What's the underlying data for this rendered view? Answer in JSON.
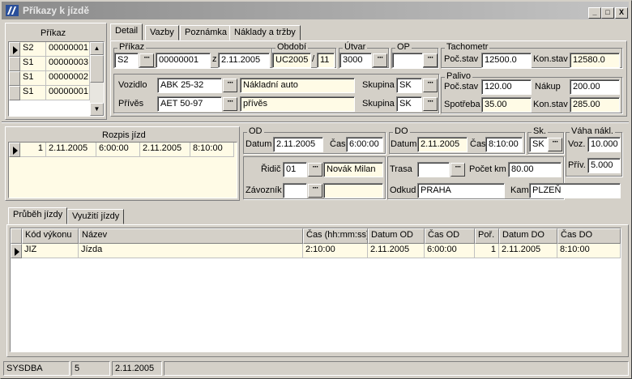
{
  "window": {
    "title": "Příkazy k jízdě",
    "min": "_",
    "max": "□",
    "close": "X"
  },
  "prikaz_list": {
    "header": "Příkaz",
    "rows": [
      {
        "a": "S2",
        "b": "00000001"
      },
      {
        "a": "S1",
        "b": "00000003"
      },
      {
        "a": "S1",
        "b": "00000002"
      },
      {
        "a": "S1",
        "b": "00000001"
      }
    ]
  },
  "top_tabs": [
    "Detail",
    "Vazby",
    "Poznámka",
    "Náklady a tržby"
  ],
  "detail": {
    "prikaz_label": "Příkaz",
    "prikaz_series": "S2",
    "prikaz_number": "00000001",
    "z_label": "z",
    "prikaz_date": "2.11.2005",
    "obdobi_label": "Období",
    "obdobi_a": "UC2005",
    "obdobi_sep": "/",
    "obdobi_b": "11",
    "utvar_label": "Útvar",
    "utvar": "3000",
    "op_label": "OP",
    "op": "",
    "tacho_label": "Tachometr",
    "poc_stav_label": "Poč.stav",
    "tacho_poc": "12500.0",
    "kon_stav_label": "Kon.stav",
    "tacho_kon": "12580.0",
    "vozidlo_label": "Vozidlo",
    "vozidlo": "ABK 25-32",
    "vozidlo_name": "Nákladní auto",
    "skupina_label": "Skupina",
    "vozidlo_skupina": "SK",
    "prives_label": "Přívěs",
    "prives": "AET 50-97",
    "prives_name": "přívěs",
    "prives_skupina": "SK",
    "palivo_label": "Palivo",
    "palivo_poc_label": "Poč.stav",
    "palivo_poc": "120.00",
    "nakup_label": "Nákup",
    "nakup": "200.00",
    "spotreba_label": "Spotřeba",
    "spotreba": "35.00",
    "palivo_kon_label": "Kon.stav",
    "palivo_kon": "285.00"
  },
  "rozpis": {
    "header": "Rozpis jízd",
    "rows": [
      {
        "n": "1",
        "d1": "2.11.2005",
        "t1": "6:00:00",
        "d2": "2.11.2005",
        "t2": "8:10:00"
      }
    ]
  },
  "od": {
    "label": "OD",
    "datum_label": "Datum",
    "datum": "2.11.2005",
    "cas_label": "Čas",
    "cas": "6:00:00"
  },
  "do": {
    "label": "DO",
    "datum_label": "Datum",
    "datum": "2.11.2005",
    "cas_label": "Čas",
    "cas": "8:10:00"
  },
  "sk": {
    "label": "Sk.",
    "value": "SK"
  },
  "vaha": {
    "label": "Váha nákl.",
    "voz_label": "Voz.",
    "voz": "10.000",
    "priv_label": "Přív.",
    "priv": "5.000"
  },
  "ridic": {
    "label": "Řidič",
    "code": "01",
    "name": "Novák Milan"
  },
  "zavoznik": {
    "label": "Závozník",
    "code": "",
    "name": ""
  },
  "trasa": {
    "label": "Trasa",
    "value": "",
    "pocet_km_label": "Počet km",
    "pocet_km": "80.00"
  },
  "odkud": {
    "label": "Odkud",
    "value": "PRAHA",
    "kam_label": "Kam",
    "kam": "PLZEŇ"
  },
  "bottom_tabs": [
    "Průběh jízdy",
    "Využití jízdy"
  ],
  "prubeh": {
    "columns": [
      "Kód výkonu",
      "Název",
      "Čas (hh:mm:ss)",
      "Datum OD",
      "Čas  OD",
      "Poř.",
      "Datum DO",
      "Čas  DO"
    ],
    "rows": [
      [
        "JIZ",
        "Jízda",
        "2:10:00",
        "2.11.2005",
        "6:00:00",
        "1",
        "2.11.2005",
        "8:10:00"
      ]
    ]
  },
  "statusbar": {
    "user": "SYSDBA",
    "num": "5",
    "date": "2.11.2005"
  }
}
